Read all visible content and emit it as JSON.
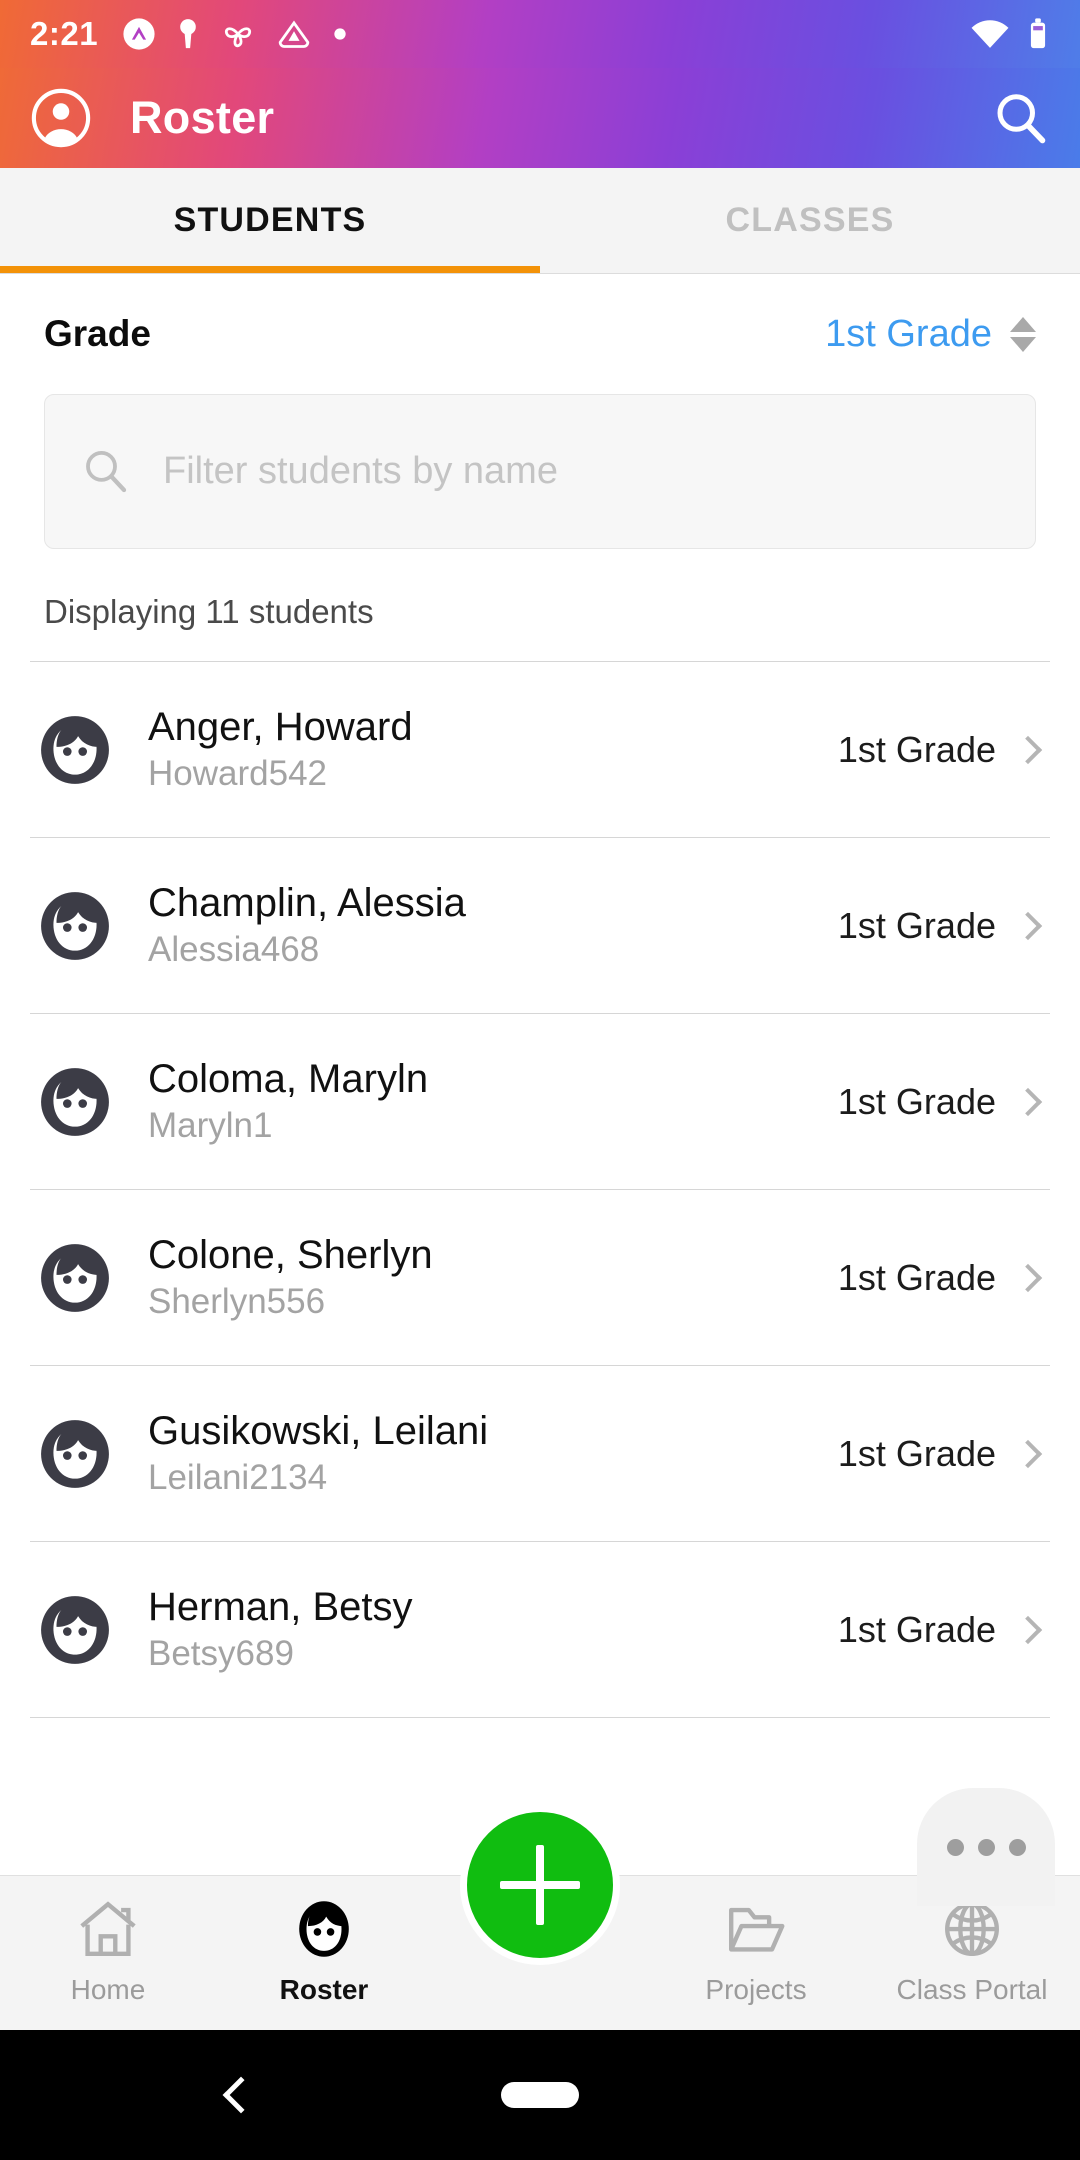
{
  "status_bar": {
    "time": "2:21",
    "left_icons": [
      "app-badge-icon",
      "keyhole-icon",
      "pinwheel-icon",
      "triangle-badge-icon",
      "dot-icon"
    ],
    "right_icons": [
      "wifi-icon",
      "battery-icon"
    ]
  },
  "app_bar": {
    "title": "Roster",
    "account_icon": "account-circle-icon",
    "search_icon": "search-icon"
  },
  "tabs": [
    {
      "label": "STUDENTS",
      "active": true
    },
    {
      "label": "CLASSES",
      "active": false
    }
  ],
  "accent_color": "#f39208",
  "link_color": "#3d9bf0",
  "fab_color": "#10bd10",
  "grade_filter": {
    "label": "Grade",
    "value": "1st Grade",
    "stepper_icon": "up-down-arrows-icon"
  },
  "search": {
    "placeholder": "Filter students by name",
    "value": "",
    "icon": "search-icon"
  },
  "list_summary": "Displaying 11 students",
  "students": [
    {
      "name": "Anger, Howard",
      "username": "Howard542",
      "grade": "1st Grade"
    },
    {
      "name": "Champlin, Alessia",
      "username": "Alessia468",
      "grade": "1st Grade"
    },
    {
      "name": "Coloma, Maryln",
      "username": "Maryln1",
      "grade": "1st Grade"
    },
    {
      "name": "Colone, Sherlyn",
      "username": "Sherlyn556",
      "grade": "1st Grade"
    },
    {
      "name": "Gusikowski, Leilani",
      "username": "Leilani2134",
      "grade": "1st Grade"
    },
    {
      "name": "Herman, Betsy",
      "username": "Betsy689",
      "grade": "1st Grade"
    }
  ],
  "overflow_button": {
    "icon": "more-horizontal-icon"
  },
  "bottom_nav": {
    "items": [
      {
        "label": "Home",
        "icon": "home-icon",
        "active": false
      },
      {
        "label": "Roster",
        "icon": "face-icon",
        "active": true
      },
      {
        "label": "Projects",
        "icon": "folder-icon",
        "active": false
      },
      {
        "label": "Class Portal",
        "icon": "globe-icon",
        "active": false
      }
    ],
    "fab": {
      "icon": "plus-icon",
      "label": ""
    }
  },
  "android_nav": {
    "back_icon": "back-chevron-icon",
    "home_icon": "home-pill-icon"
  }
}
